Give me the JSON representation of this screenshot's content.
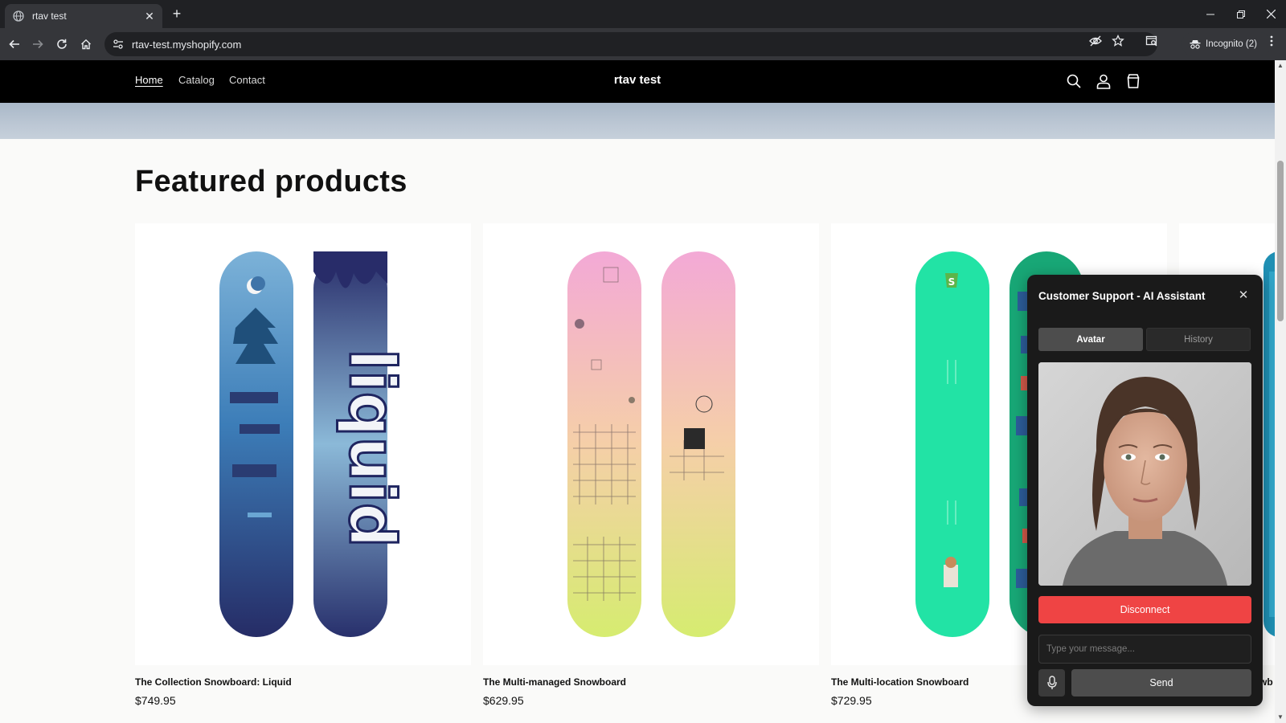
{
  "browser": {
    "tab_title": "rtav test",
    "new_tab_icon": "plus-icon",
    "url": "rtav-test.myshopify.com",
    "incognito_label": "Incognito (2)"
  },
  "site": {
    "title": "rtav test",
    "nav": [
      {
        "label": "Home",
        "active": true
      },
      {
        "label": "Catalog",
        "active": false
      },
      {
        "label": "Contact",
        "active": false
      }
    ],
    "section_title": "Featured products",
    "products": [
      {
        "name": "The Collection Snowboard: Liquid",
        "price": "$749.95"
      },
      {
        "name": "The Multi-managed Snowboard",
        "price": "$629.95"
      },
      {
        "name": "The Multi-location Snowboard",
        "price": "$729.95"
      },
      {
        "name": "wb",
        "price": ""
      }
    ]
  },
  "chat": {
    "title": "Customer Support - AI Assistant",
    "tabs": [
      "Avatar",
      "History"
    ],
    "active_tab": "Avatar",
    "disconnect_label": "Disconnect",
    "input_placeholder": "Type your message...",
    "send_label": "Send"
  },
  "colors": {
    "disconnect": "#ef4444",
    "header_bg": "#000000",
    "chat_bg": "#1a1a1a"
  }
}
